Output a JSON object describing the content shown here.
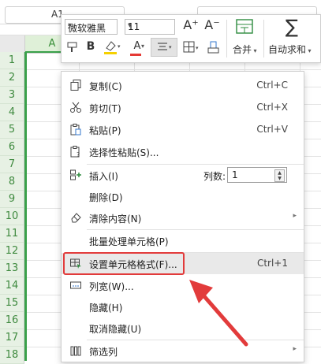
{
  "namebox": {
    "value": "A1"
  },
  "sheet": {
    "column_header": "A",
    "row_numbers": [
      "1",
      "2",
      "3",
      "4",
      "5",
      "6",
      "7",
      "8",
      "9",
      "10",
      "11",
      "12",
      "13",
      "14",
      "15",
      "16",
      "17",
      "18"
    ]
  },
  "mini_toolbar": {
    "font_name": "微软雅黑",
    "font_size": "11",
    "grow_font_icon": "A⁺",
    "shrink_font_icon": "A⁻",
    "bold_label": "B",
    "font_color_label": "A",
    "merge_label": "合并",
    "autosum_label": "自动求和",
    "colors": {
      "highlight": "#f5d000",
      "font_color": "#e53935"
    }
  },
  "context_menu": {
    "items": [
      {
        "label": "复制(C)",
        "shortcut": "Ctrl+C",
        "icon": "copy-icon"
      },
      {
        "label": "剪切(T)",
        "shortcut": "Ctrl+X",
        "icon": "scissors-icon"
      },
      {
        "label": "粘贴(P)",
        "shortcut": "Ctrl+V",
        "icon": "paste-icon"
      },
      {
        "label": "选择性粘贴(S)...",
        "shortcut": "",
        "icon": "paste-special-icon"
      },
      {
        "label": "插入(I)",
        "shortcut": "",
        "icon": "insert-icon"
      },
      {
        "label": "删除(D)",
        "shortcut": "",
        "icon": ""
      },
      {
        "label": "清除内容(N)",
        "shortcut": "",
        "icon": "eraser-icon"
      },
      {
        "label": "批量处理单元格(P)",
        "shortcut": "",
        "icon": ""
      },
      {
        "label": "设置单元格格式(F)...",
        "shortcut": "Ctrl+1",
        "icon": "format-cells-icon"
      },
      {
        "label": "列宽(W)...",
        "shortcut": "",
        "icon": "column-width-icon"
      },
      {
        "label": "隐藏(H)",
        "shortcut": "",
        "icon": ""
      },
      {
        "label": "取消隐藏(U)",
        "shortcut": "",
        "icon": ""
      },
      {
        "label": "筛选列",
        "shortcut": "",
        "icon": "filter-columns-icon"
      }
    ],
    "insert_count_label": "列数:",
    "insert_count_value": "1"
  }
}
